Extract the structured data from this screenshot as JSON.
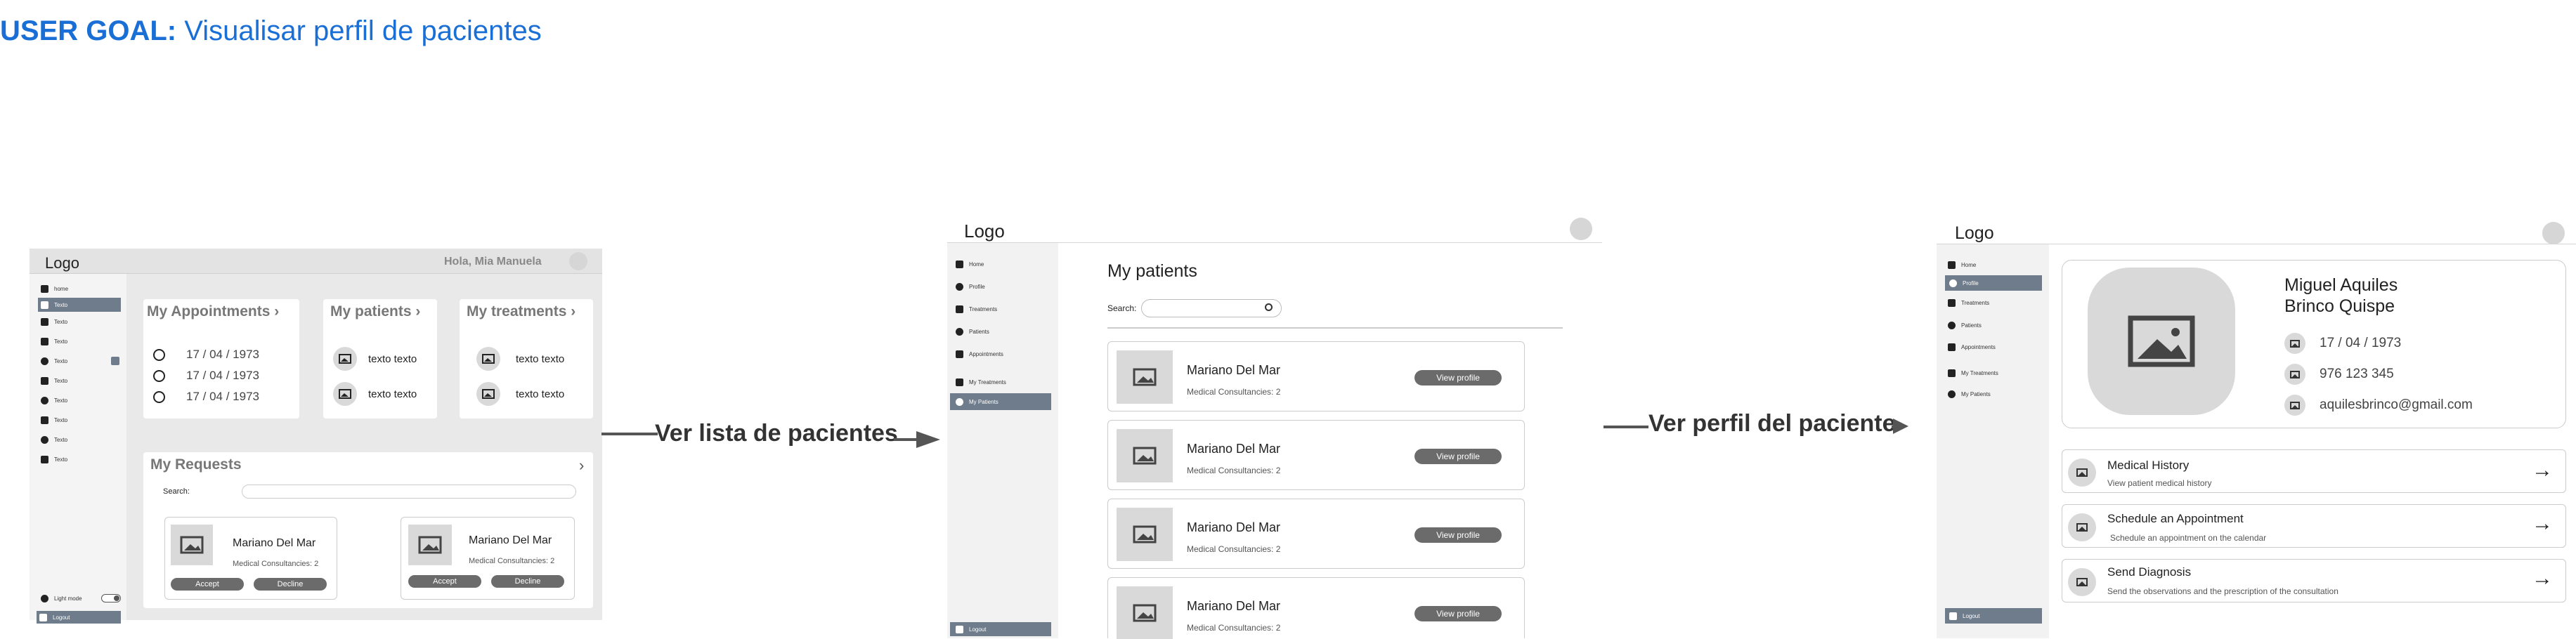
{
  "user_goal": {
    "prefix": "USER GOAL:",
    "text": "Visualisar perfil de pacientes"
  },
  "flows": {
    "arrow1_label": "Ver lista de pacientes",
    "arrow2_label": "Ver perfil del paciente"
  },
  "screen1": {
    "logo": "Logo",
    "greeting": "Hola, Mia Manuela",
    "sidebar_items": [
      "home",
      "Texto",
      "Texto",
      "Texto",
      "Texto",
      "Texto",
      "Texto",
      "Texto",
      "Texto",
      "Texto"
    ],
    "light_mode": "Light mode",
    "logout": "Logout",
    "appointments_title": "My Appointments",
    "appointments": [
      "17 / 04 / 1973",
      "17 / 04 / 1973",
      "17 / 04 / 1973"
    ],
    "patients_title": "My patients",
    "patients": [
      "texto texto",
      "texto texto"
    ],
    "treatments_title": "My treatments",
    "treatments": [
      "texto texto",
      "texto texto"
    ],
    "requests_title": "My Requests",
    "search_label": "Search:",
    "requests": [
      {
        "name": "Mariano Del Mar",
        "consultancies": "Medical Consultancies: 2",
        "accept": "Accept",
        "decline": "Decline"
      },
      {
        "name": "Mariano Del Mar",
        "consultancies": "Medical Consultancies: 2",
        "accept": "Accept",
        "decline": "Decline"
      }
    ]
  },
  "screen2": {
    "logo": "Logo",
    "sidebar_items": [
      "Home",
      "Profile",
      "Treatments",
      "Patients",
      "Appointments",
      "My Treatments",
      "My Patients"
    ],
    "logout": "Logout",
    "title": "My patients",
    "search_label": "Search:",
    "patients": [
      {
        "name": "Mariano Del Mar",
        "consultancies": "Medical Consultancies: 2",
        "button": "View profile"
      },
      {
        "name": "Mariano Del Mar",
        "consultancies": "Medical Consultancies: 2",
        "button": "View profile"
      },
      {
        "name": "Mariano Del Mar",
        "consultancies": "Medical Consultancies: 2",
        "button": "View profile"
      },
      {
        "name": "Mariano Del Mar",
        "consultancies": "Medical Consultancies: 2",
        "button": "View profile"
      }
    ]
  },
  "screen3": {
    "logo": "Logo",
    "sidebar_items": [
      "Home",
      "Profile",
      "Treatments",
      "Patients",
      "Appointments",
      "My Treatments",
      "My Patients"
    ],
    "logout": "Logout",
    "patient_name_line1": "Miguel Aquiles",
    "patient_name_line2": "Brinco Quispe",
    "birthdate": "17 / 04 / 1973",
    "phone": "976 123 345",
    "email": "aquilesbrinco@gmail.com",
    "actions": [
      {
        "title": "Medical History",
        "subtitle": "View patient medical history"
      },
      {
        "title": "Schedule an Appointment",
        "subtitle": "Schedule an appointment on the calendar"
      },
      {
        "title": "Send Diagnosis",
        "subtitle": "Send the observations and the prescription of the consultation"
      }
    ]
  }
}
